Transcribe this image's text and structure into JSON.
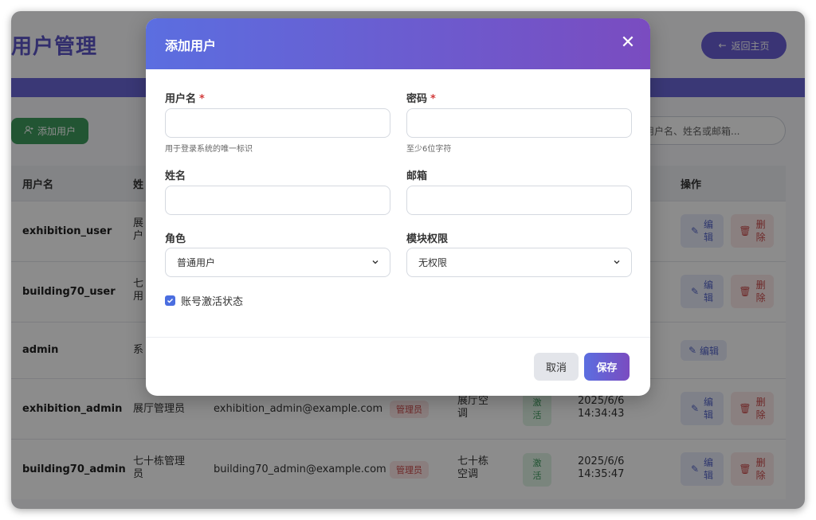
{
  "page": {
    "title": "用户管理",
    "back_label": "返回主页",
    "add_user_label": "添加用户",
    "search_placeholder": "用户名、姓名或邮箱..."
  },
  "table": {
    "headers": [
      "用户名",
      "姓",
      "操作"
    ],
    "rows": [
      {
        "username": "exhibition_user",
        "name_lines": [
          "展",
          "户"
        ]
      },
      {
        "username": "building70_user",
        "name_lines": [
          "七",
          "用"
        ]
      },
      {
        "username": "admin",
        "name_lines": [
          "系"
        ]
      },
      {
        "username": "exhibition_admin",
        "name_lines": [
          "展厅管理员"
        ],
        "email": "exhibition_admin@example.com",
        "role": "管理员",
        "module_lines": [
          "展厅空",
          "调"
        ],
        "status_lines": [
          "激",
          "活"
        ],
        "date": "2025/6/6",
        "time": "14:34:43"
      },
      {
        "username": "building70_admin",
        "name_lines": [
          "七十栋管理",
          "员"
        ],
        "email": "building70_admin@example.com",
        "role": "管理员",
        "module_lines": [
          "七十栋",
          "空调"
        ],
        "status_lines": [
          "激",
          "活"
        ],
        "date": "2025/6/6",
        "time": "14:35:47"
      }
    ],
    "actions": {
      "edit_lines": [
        "编",
        "辑"
      ],
      "delete_lines": [
        "删",
        "除"
      ],
      "edit_single": "编辑"
    }
  },
  "modal": {
    "title": "添加用户",
    "close_glyph": "✕",
    "required_mark": "*",
    "username_label": "用户名",
    "username_help": "用于登录系统的唯一标识",
    "password_label": "密码",
    "password_help": "至少6位字符",
    "name_label": "姓名",
    "email_label": "邮箱",
    "role_label": "角色",
    "role_value": "普通用户",
    "module_label": "模块权限",
    "module_value": "无权限",
    "active_label": "账号激活状态",
    "cancel_label": "取消",
    "save_label": "保存"
  },
  "colors": {
    "accent": "#5b6ee0",
    "accent_end": "#7a4cc0",
    "add_green": "#3f9b5e",
    "danger": "#c94a4a"
  }
}
